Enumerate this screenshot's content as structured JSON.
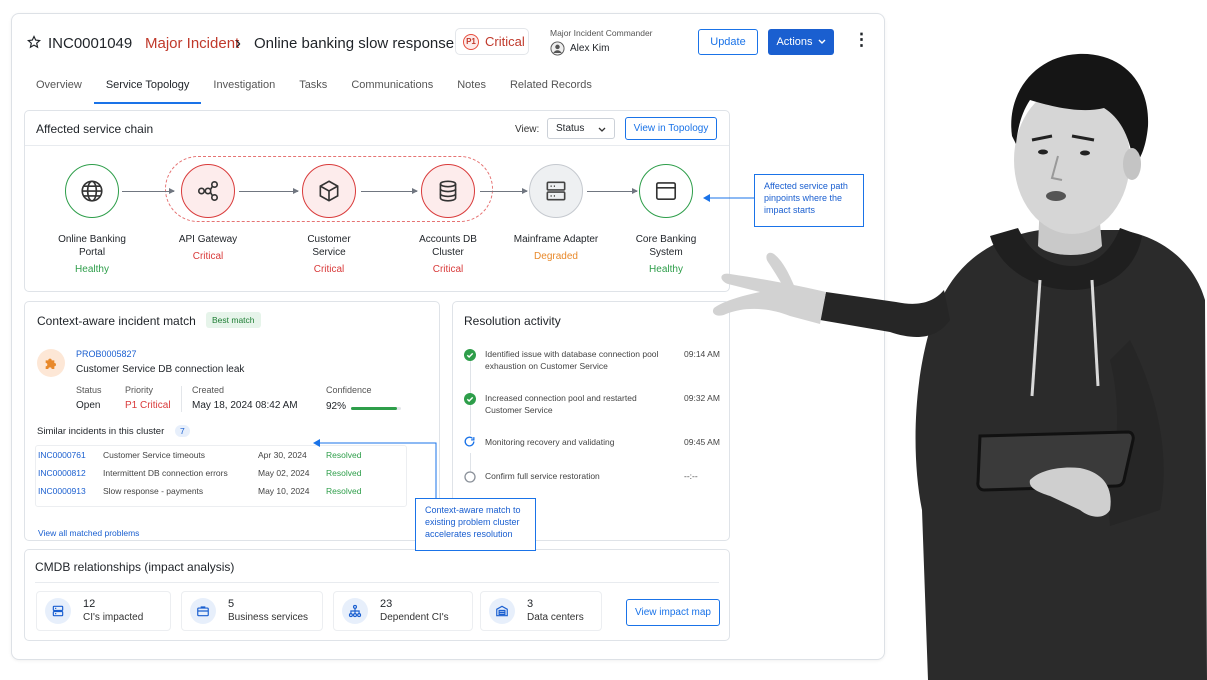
{
  "header": {
    "incident_id": "INC0001049",
    "category": "Major Incident",
    "breadcrumb_sep": "›",
    "title": "Online banking slow response",
    "priority_badge": "P1",
    "priority_label": "Critical",
    "commander_label": "Major Incident Commander",
    "commander_name": "Alex Kim",
    "update_label": "Update",
    "actions_label": "Actions",
    "more_glyph": "⋮"
  },
  "tabs": [
    "Overview",
    "Service Topology",
    "Investigation",
    "Tasks",
    "Communications",
    "Notes",
    "Related Records"
  ],
  "chain": {
    "title": "Affected service chain",
    "view_label": "View:",
    "view_value": "Status",
    "view_topology": "View in Topology",
    "nodes": [
      {
        "name": "Online Banking\nPortal",
        "status": "Healthy",
        "icon": "globe-icon",
        "state": "green"
      },
      {
        "name": "API Gateway",
        "status": "Critical",
        "icon": "network-icon",
        "state": "red"
      },
      {
        "name": "Customer\nService",
        "status": "Critical",
        "icon": "cube-icon",
        "state": "red"
      },
      {
        "name": "Accounts DB\nCluster",
        "status": "Critical",
        "icon": "database-icon",
        "state": "red"
      },
      {
        "name": "Mainframe Adapter",
        "status": "Degraded",
        "icon": "server-icon",
        "state": "grey"
      },
      {
        "name": "Core Banking\nSystem",
        "status": "Healthy",
        "icon": "window-icon",
        "state": "green"
      }
    ],
    "callout": "Affected service path pinpoints where the impact starts"
  },
  "match": {
    "title": "Context-aware incident match",
    "badge": "Best match",
    "problem_id": "PROB0005827",
    "problem_title": "Customer Service DB connection leak",
    "status_label": "Status",
    "status_value": "Open",
    "priority_label": "Priority",
    "priority_value": "P1 Critical",
    "created_label": "Created",
    "created_value": "May 18, 2024 08:42 AM",
    "confidence_label": "Confidence",
    "confidence_value": "92%",
    "confidence_fraction": 0.92,
    "similar_label": "Similar incidents in this cluster",
    "similar_count": "7",
    "rows": [
      {
        "id": "INC0000761",
        "desc": "Customer Service timeouts",
        "date": "Apr 30, 2024",
        "status": "Resolved"
      },
      {
        "id": "INC0000812",
        "desc": "Intermittent DB connection errors",
        "date": "May 02, 2024",
        "status": "Resolved"
      },
      {
        "id": "INC0000913",
        "desc": "Slow response - payments",
        "date": "May 10, 2024",
        "status": "Resolved"
      }
    ],
    "view_all": "View all matched problems",
    "callout": "Context-aware match to existing problem cluster accelerates resolution"
  },
  "activity": {
    "title": "Resolution activity",
    "items": [
      {
        "text": "Identified issue with database connection pool exhaustion on Customer Service",
        "time": "09:14 AM",
        "state": "done"
      },
      {
        "text": "Increased connection pool and restarted Customer Service",
        "time": "09:32 AM",
        "state": "done"
      },
      {
        "text": "Monitoring recovery and validating",
        "time": "09:45 AM",
        "state": "progress"
      },
      {
        "text": "Confirm full service restoration",
        "time": "--:--",
        "state": "pending"
      }
    ]
  },
  "cmdb": {
    "title": "CMDB relationships (impact analysis)",
    "stats": [
      {
        "num": "12",
        "label": "CI's impacted",
        "icon": "server-stack-icon"
      },
      {
        "num": "5",
        "label": "Business services",
        "icon": "briefcase-icon"
      },
      {
        "num": "23",
        "label": "Dependent CI's",
        "icon": "hierarchy-icon"
      },
      {
        "num": "3",
        "label": "Data centers",
        "icon": "datacenter-icon"
      }
    ],
    "view_impact": "View impact map"
  },
  "colors": {
    "accent": "#1a73e8",
    "critical": "#d93b3b",
    "healthy": "#2e9e4a",
    "degraded": "#e8892b"
  }
}
